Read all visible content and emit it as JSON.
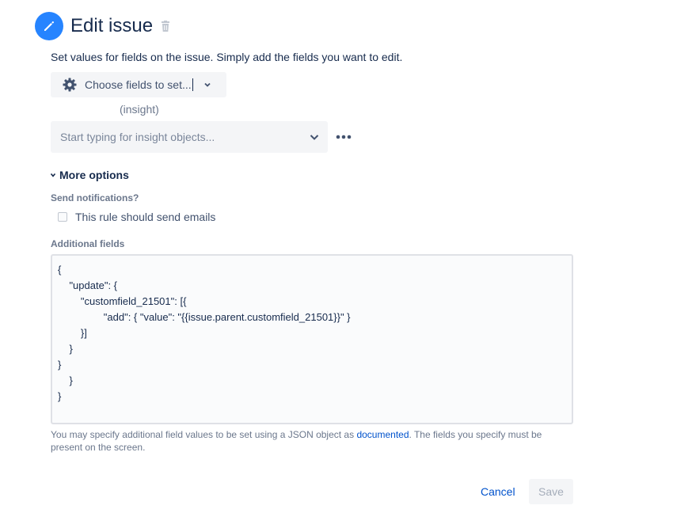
{
  "header": {
    "title": "Edit issue",
    "icon": "pencil-icon",
    "delete_icon": "trash-icon"
  },
  "subtitle": "Set values for fields on the issue. Simply add the fields you want to edit.",
  "choose_fields": {
    "label": "Choose fields to set...",
    "icon": "gear-icon"
  },
  "insight": {
    "field_label": "(insight)",
    "placeholder": "Start typing for insight objects..."
  },
  "more_options": {
    "label": "More options"
  },
  "notifications": {
    "label": "Send notifications?",
    "checkbox_label": "This rule should send emails",
    "checked": false
  },
  "additional_fields": {
    "label": "Additional fields",
    "value": "{\n    \"update\": {\n        \"customfield_21501\": [{\n                \"add\": { \"value\": \"{{issue.parent.customfield_21501}}\" }\n        }]\n    }\n}\n    }\n}",
    "help_before": "You may specify additional field values to be set using a JSON object as ",
    "help_link": "documented",
    "help_after": ". The fields you specify must be present on the screen."
  },
  "actions": {
    "cancel": "Cancel",
    "save": "Save"
  },
  "colors": {
    "accent": "#2684ff",
    "link": "#0052cc",
    "field_bg": "#f4f5f7"
  }
}
